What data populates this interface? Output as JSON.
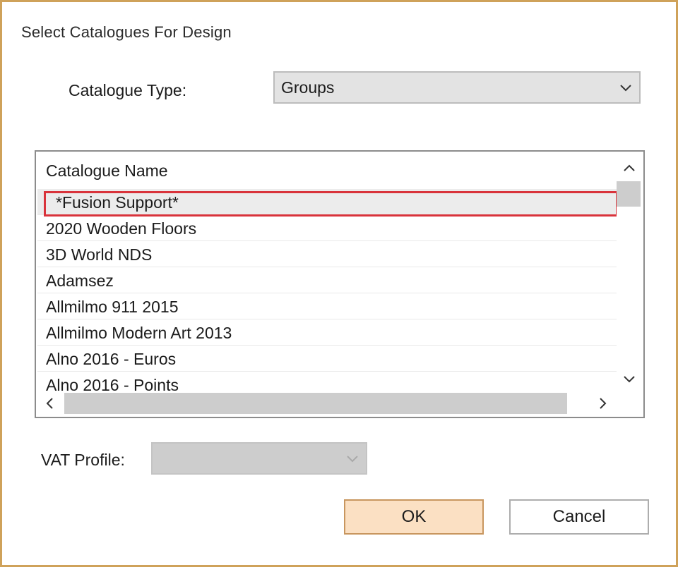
{
  "dialog": {
    "title": "Select Catalogues For Design",
    "accent_border": "#cfa25a"
  },
  "catalogue_type": {
    "label": "Catalogue Type:",
    "value": "Groups"
  },
  "list": {
    "header": "Catalogue Name",
    "rows": [
      "*Fusion Support*",
      "2020 Wooden Floors",
      "3D World NDS",
      "Adamsez",
      "Allmilmo 911 2015",
      "Allmilmo Modern Art 2013",
      "Alno 2016 - Euros",
      "Alno 2016 - Points"
    ],
    "selected_index": 0,
    "highlight_color": "#d9333b"
  },
  "vat_profile": {
    "label": "VAT Profile:",
    "value": ""
  },
  "buttons": {
    "ok": "OK",
    "cancel": "Cancel"
  },
  "icons": {
    "combo_arrow": "chevron-down-icon",
    "scroll_up": "chevron-up-icon",
    "scroll_down": "chevron-down-icon",
    "scroll_left": "chevron-left-icon",
    "scroll_right": "chevron-right-icon"
  }
}
